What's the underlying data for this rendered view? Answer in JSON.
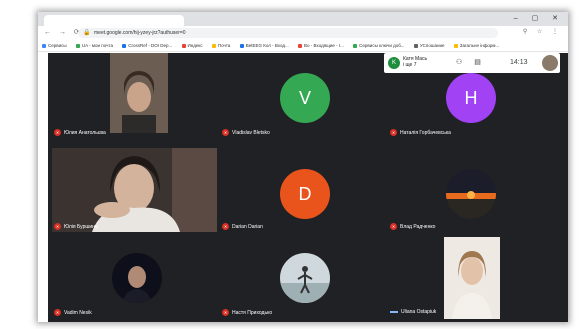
{
  "browser": {
    "url": "meet.google.com/hij-yzey-jrz?authuser=0",
    "bookmarks": [
      {
        "label": "Сервисы",
        "color": "#4285f4"
      },
      {
        "label": "UA - мои почта",
        "color": "#34a853"
      },
      {
        "label": "CrossRef - DOI Dep...",
        "color": "#1a73e8"
      },
      {
        "label": "Индекс",
        "color": "#ea4335"
      },
      {
        "label": "Почта",
        "color": "#fbbc04"
      },
      {
        "label": "BetEEG Кол - Вход...",
        "color": "#1a73e8"
      },
      {
        "label": "Во - Входящие - I...",
        "color": "#ea4335"
      },
      {
        "label": "Сервисы ключи доб...",
        "color": "#34a853"
      },
      {
        "label": "УСпошание",
        "color": "#5f6368"
      },
      {
        "label": "Загальне інформ...",
        "color": "#fbbc04"
      }
    ]
  },
  "toast": {
    "badge": "K",
    "name": "Катя Мась",
    "sub": "і ще 7",
    "time": "14:13"
  },
  "participants": [
    {
      "name": "Юлия Анатольєва",
      "kind": "video"
    },
    {
      "name": "Vladislav Bletsko",
      "kind": "avatar",
      "letter": "V",
      "color": "#34a853"
    },
    {
      "name": "Наталія Горбачевська",
      "kind": "avatar",
      "letter": "H",
      "color": "#a142f4"
    },
    {
      "name": "Юлія Буршина",
      "kind": "video"
    },
    {
      "name": "Darian Darian",
      "kind": "avatar",
      "letter": "D",
      "color": "#e8541c"
    },
    {
      "name": "Влад Радченко",
      "kind": "photo"
    },
    {
      "name": "Vadim Nesik",
      "kind": "photo"
    },
    {
      "name": "Настя Приходько",
      "kind": "photo"
    },
    {
      "name": "Uliana Ostapiuk",
      "kind": "video"
    }
  ]
}
